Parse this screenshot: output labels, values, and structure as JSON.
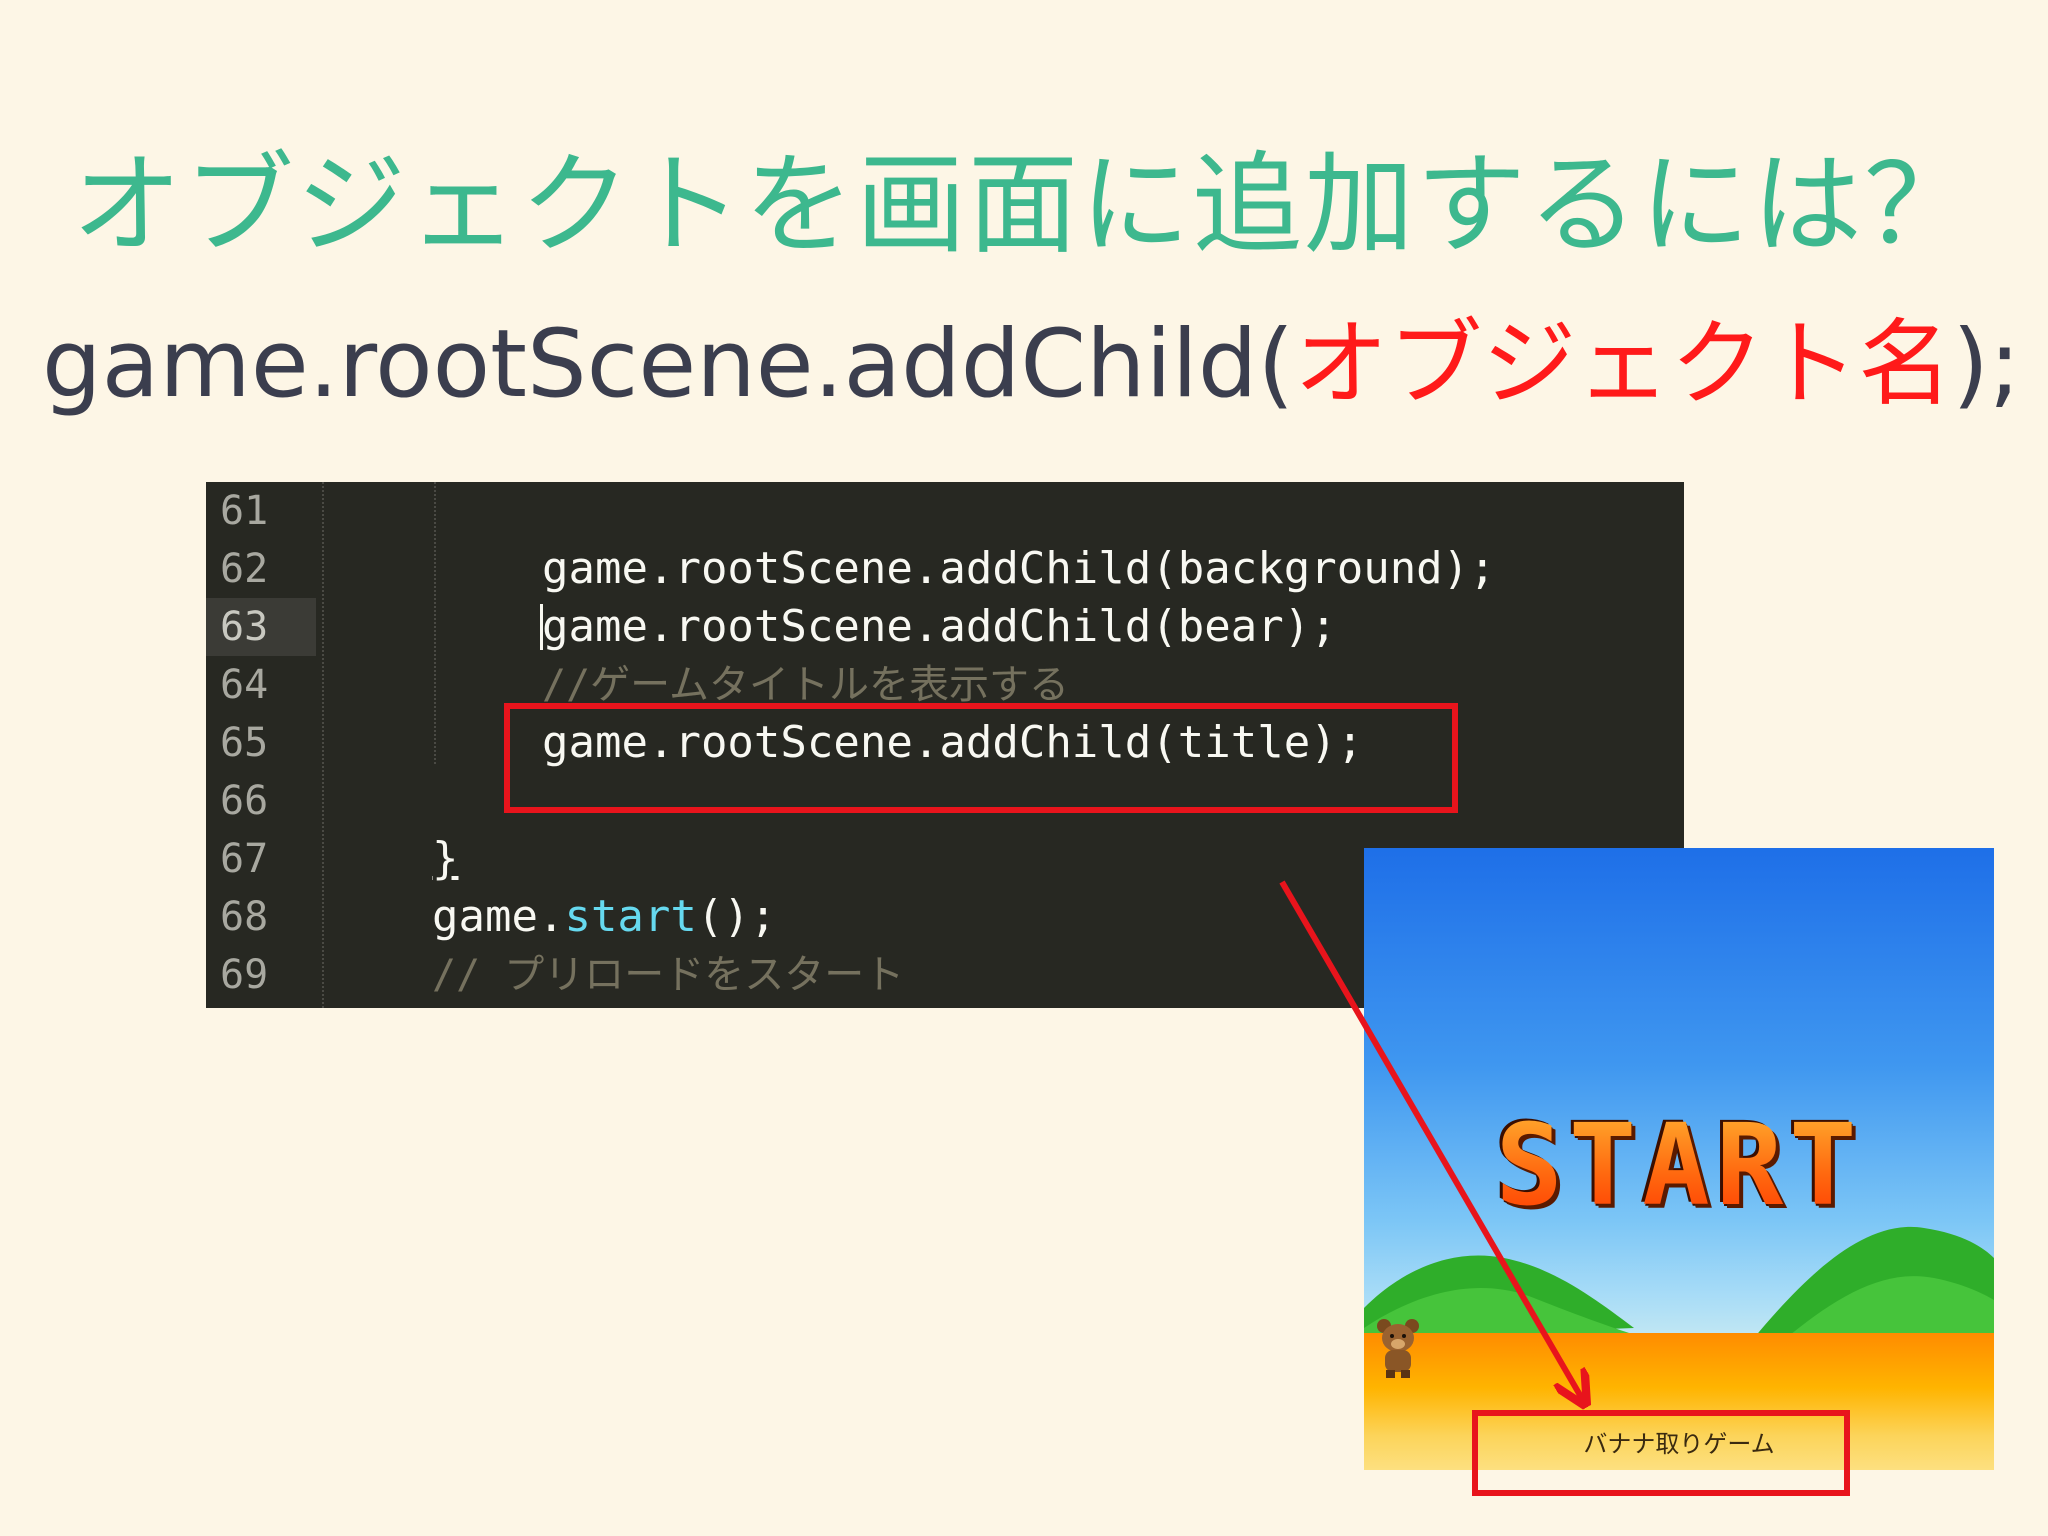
{
  "slide": {
    "title": "オブジェクトを画面に追加するには？",
    "code_prefix": "game.rootScene.addChild(",
    "code_highlight": "オブジェクト名",
    "code_suffix": ");"
  },
  "editor": {
    "lines": [
      {
        "number": "61",
        "text": ""
      },
      {
        "number": "62",
        "text": "game.rootScene.addChild(background);"
      },
      {
        "number": "63",
        "text": "game.rootScene.addChild(bear);"
      },
      {
        "number": "64",
        "text": "//ゲームタイトルを表示する"
      },
      {
        "number": "65",
        "text": "game.rootScene.addChild(title);"
      },
      {
        "number": "66",
        "text": ""
      },
      {
        "number": "67",
        "text": "}"
      },
      {
        "number": "68",
        "text_object": "game.",
        "text_method": "start",
        "text_rest": "();"
      },
      {
        "number": "69",
        "text": "// プリロードをスタート"
      }
    ]
  },
  "game": {
    "logo_text": "START",
    "title_label": "バナナ取りゲーム"
  },
  "colors": {
    "title": "#3db88e",
    "highlight": "#ff1a1a",
    "box": "#e8141c",
    "editor_bg": "#272822"
  }
}
